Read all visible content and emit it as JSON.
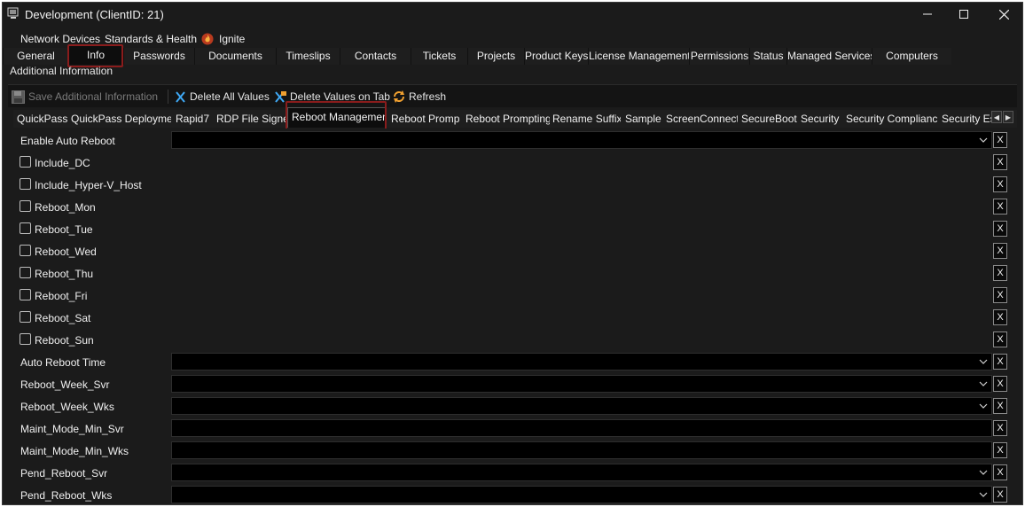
{
  "window": {
    "title": "Development   (ClientID: 21)",
    "icons": {
      "app": "app-window-icon",
      "minimize": "minimize-icon",
      "maximize": "maximize-icon",
      "close": "close-icon"
    }
  },
  "tabs_row1": [
    {
      "label": "Network Devices"
    },
    {
      "label": "Standards & Health"
    },
    {
      "label": "Ignite",
      "icon": "ignite-icon"
    }
  ],
  "tabs_row2": [
    {
      "label": "General"
    },
    {
      "label": "Info",
      "active": true
    },
    {
      "label": "Passwords"
    },
    {
      "label": "Documents"
    },
    {
      "label": "Timeslips"
    },
    {
      "label": "Contacts"
    },
    {
      "label": "Tickets"
    },
    {
      "label": "Projects"
    },
    {
      "label": "Product Keys"
    },
    {
      "label": "License Management"
    },
    {
      "label": "Permissions"
    },
    {
      "label": "Status"
    },
    {
      "label": "Managed Services"
    },
    {
      "label": "Computers"
    }
  ],
  "section_label": "Additional Information",
  "toolbar": {
    "save_label": "Save Additional Information",
    "delete_all_label": "Delete All Values",
    "delete_tab_label": "Delete Values on Tab",
    "refresh_label": "Refresh"
  },
  "subtabs": [
    {
      "label": "QuickPass"
    },
    {
      "label": "QuickPass Deployment"
    },
    {
      "label": "Rapid7"
    },
    {
      "label": "RDP File Signer"
    },
    {
      "label": "Reboot Management",
      "active": true
    },
    {
      "label": "Reboot Prompt"
    },
    {
      "label": "Reboot Prompting"
    },
    {
      "label": "Rename Suffix"
    },
    {
      "label": "Sample"
    },
    {
      "label": "ScreenConnect"
    },
    {
      "label": "SecureBoot"
    },
    {
      "label": "Security"
    },
    {
      "label": "Security Compliance"
    },
    {
      "label": "Security Es"
    }
  ],
  "fields": [
    {
      "label": "Enable Auto Reboot",
      "type": "dropdown",
      "value": ""
    },
    {
      "label": "Include_DC",
      "type": "checkbox",
      "checked": false
    },
    {
      "label": "Include_Hyper-V_Host",
      "type": "checkbox",
      "checked": false
    },
    {
      "label": "Reboot_Mon",
      "type": "checkbox",
      "checked": false
    },
    {
      "label": "Reboot_Tue",
      "type": "checkbox",
      "checked": false
    },
    {
      "label": "Reboot_Wed",
      "type": "checkbox",
      "checked": false
    },
    {
      "label": "Reboot_Thu",
      "type": "checkbox",
      "checked": false
    },
    {
      "label": "Reboot_Fri",
      "type": "checkbox",
      "checked": false
    },
    {
      "label": "Reboot_Sat",
      "type": "checkbox",
      "checked": false
    },
    {
      "label": "Reboot_Sun",
      "type": "checkbox",
      "checked": false
    },
    {
      "label": "Auto Reboot Time",
      "type": "dropdown",
      "value": ""
    },
    {
      "label": "Reboot_Week_Svr",
      "type": "dropdown",
      "value": ""
    },
    {
      "label": "Reboot_Week_Wks",
      "type": "dropdown",
      "value": ""
    },
    {
      "label": "Maint_Mode_Min_Svr",
      "type": "text",
      "value": ""
    },
    {
      "label": "Maint_Mode_Min_Wks",
      "type": "text",
      "value": ""
    },
    {
      "label": "Pend_Reboot_Svr",
      "type": "dropdown",
      "value": ""
    },
    {
      "label": "Pend_Reboot_Wks",
      "type": "dropdown",
      "value": ""
    }
  ],
  "clear_button_label": "X",
  "colors": {
    "background": "#1b1b1b",
    "field": "#000000",
    "highlight": "#8a1c1c",
    "accent_blue": "#3fa9f5",
    "refresh_orange": "#f0a030"
  }
}
